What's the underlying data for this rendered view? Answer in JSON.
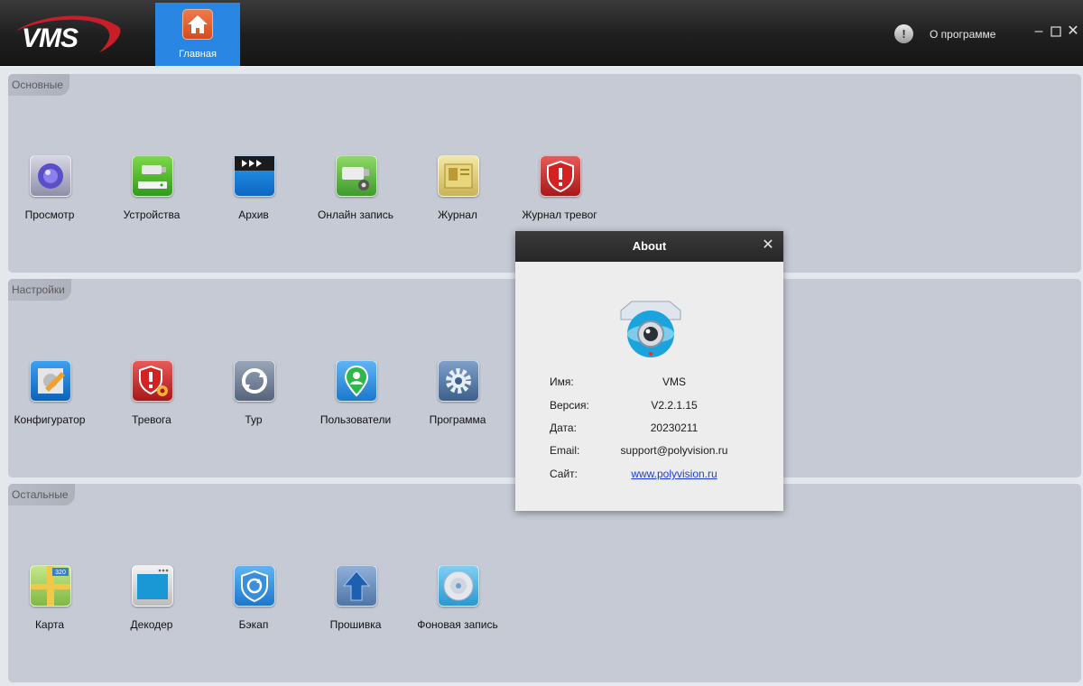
{
  "header": {
    "logo_text": "VMS",
    "home_tab_label": "Главная",
    "about_label": "О программе",
    "window_controls": [
      "minimize-icon",
      "maximize-icon",
      "close-icon"
    ],
    "accent_color": "#2a86e3"
  },
  "sections": [
    {
      "label": "Основные",
      "tiles": [
        {
          "label": "Просмотр",
          "icon": "preview-icon"
        },
        {
          "label": "Устройства",
          "icon": "devices-icon"
        },
        {
          "label": "Архив",
          "icon": "archive-icon"
        },
        {
          "label": "Онлайн запись",
          "icon": "online-record-icon"
        },
        {
          "label": "Журнал",
          "icon": "journal-icon"
        },
        {
          "label": "Журнал тревог",
          "icon": "alarm-journal-icon"
        }
      ]
    },
    {
      "label": "Настройки",
      "tiles": [
        {
          "label": "Конфигуратор",
          "icon": "configurator-icon"
        },
        {
          "label": "Тревога",
          "icon": "alarm-icon"
        },
        {
          "label": "Тур",
          "icon": "tour-icon"
        },
        {
          "label": "Пользователи",
          "icon": "users-icon"
        },
        {
          "label": "Программа",
          "icon": "program-gear-icon"
        }
      ]
    },
    {
      "label": "Остальные",
      "tiles": [
        {
          "label": "Карта",
          "icon": "map-icon"
        },
        {
          "label": "Декодер",
          "icon": "decoder-icon"
        },
        {
          "label": "Бэкап",
          "icon": "backup-icon"
        },
        {
          "label": "Прошивка",
          "icon": "firmware-upload-icon"
        },
        {
          "label": "Фоновая запись",
          "icon": "background-record-icon"
        }
      ]
    }
  ],
  "about_dialog": {
    "title": "About",
    "rows": [
      {
        "key": "Имя:",
        "value": "VMS"
      },
      {
        "key": "Версия:",
        "value": "V2.2.1.15"
      },
      {
        "key": "Дата:",
        "value": "20230211"
      },
      {
        "key": "Email:",
        "value": "support@polyvision.ru"
      },
      {
        "key": "Сайт:",
        "value": "www.polyvision.ru"
      }
    ]
  }
}
